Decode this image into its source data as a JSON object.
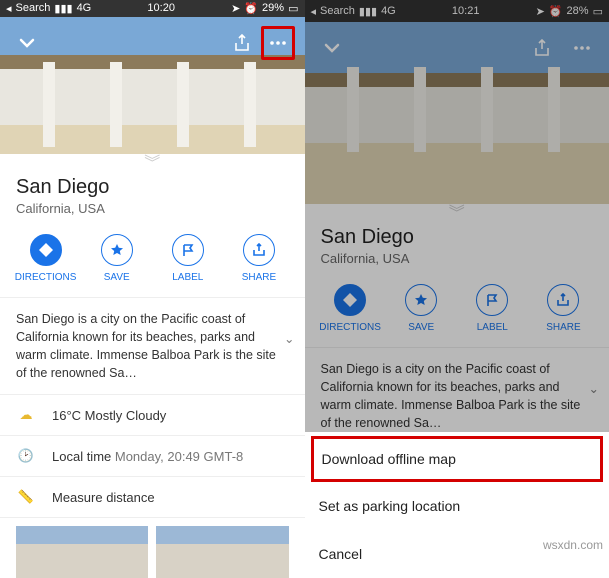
{
  "status": {
    "back": "Search",
    "signal": "4G",
    "time_left": "10:20",
    "time_right": "10:21",
    "battery_left": "29%",
    "battery_right": "28%"
  },
  "place": {
    "name": "San Diego",
    "region": "California, USA",
    "description": "San Diego is a city on the Pacific coast of California known for its beaches, parks and warm climate. Immense Balboa Park is the site of the renowned Sa…",
    "weather": "16°C Mostly Cloudy",
    "localtime_label": "Local time",
    "localtime_value": "Monday, 20:49 GMT-8",
    "measure": "Measure distance"
  },
  "actions": {
    "directions": "DIRECTIONS",
    "save": "SAVE",
    "label": "LABEL",
    "share": "SHARE"
  },
  "menu": {
    "download": "Download offline map",
    "parking": "Set as parking location",
    "cancel": "Cancel"
  },
  "watermark": "wsxdn.com"
}
